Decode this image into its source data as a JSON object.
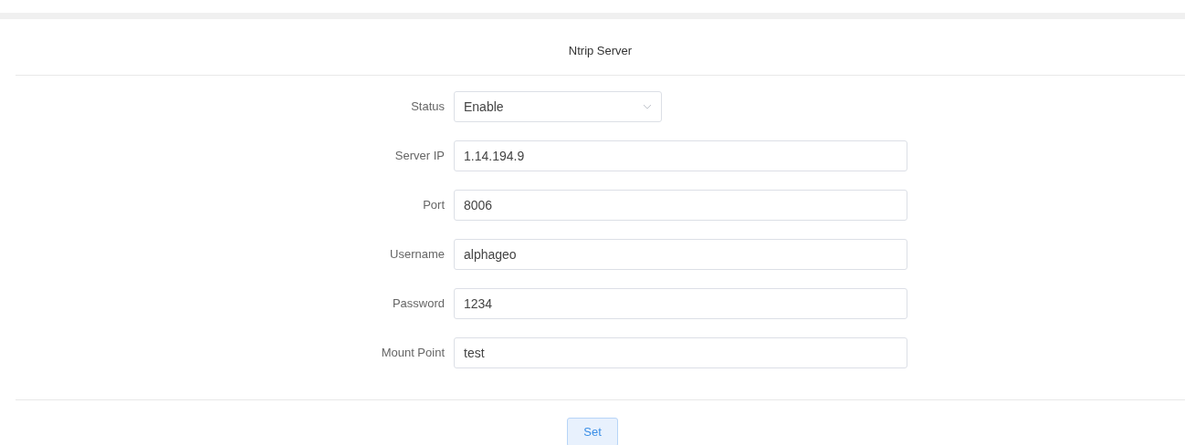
{
  "title": "Ntrip Server",
  "fields": [
    {
      "label": "Status",
      "kind": "select",
      "value": "Enable"
    },
    {
      "label": "Server IP",
      "kind": "text",
      "value": "1.14.194.9"
    },
    {
      "label": "Port",
      "kind": "text",
      "value": "8006"
    },
    {
      "label": "Username",
      "kind": "text",
      "value": "alphageo"
    },
    {
      "label": "Password",
      "kind": "text",
      "value": "1234"
    },
    {
      "label": "Mount Point",
      "kind": "text",
      "value": "test"
    }
  ],
  "button": "Set"
}
